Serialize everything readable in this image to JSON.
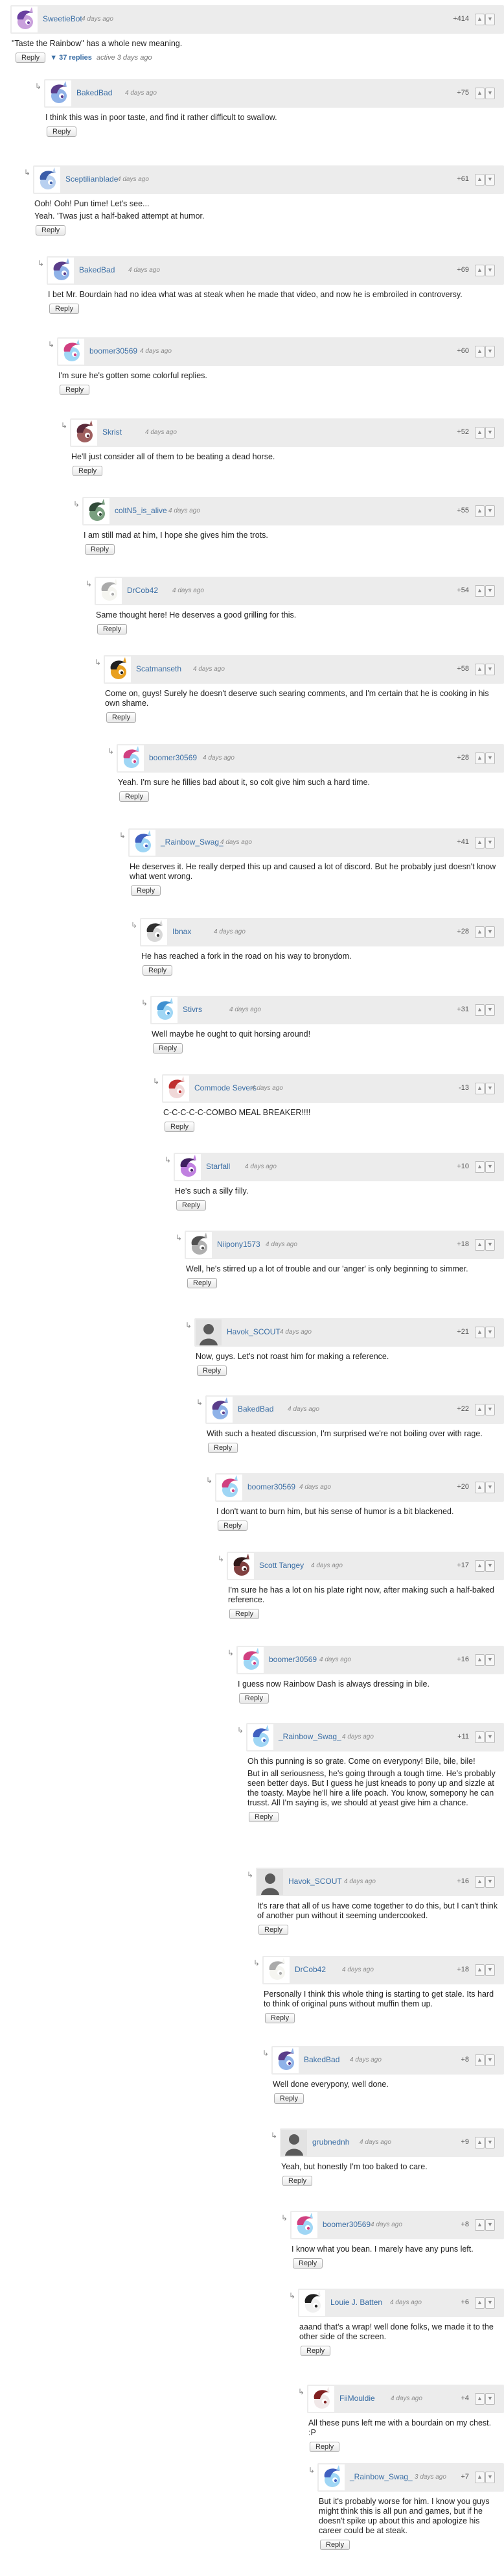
{
  "ui": {
    "reply_label": "Reply",
    "arrow_glyph": "↳",
    "up_glyph": "▲",
    "down_glyph": "▼"
  },
  "comments": [
    {
      "user": "SweetieBot",
      "time": "4 days ago",
      "score": "+414",
      "body": [
        "\"Taste the Rainbow\" has a whole new meaning."
      ],
      "replies": "▼ 37 replies",
      "active": "active 3 days ago",
      "avatar": "sweetiebot-avatar",
      "colors": [
        "#c9a0dc",
        "#6a3fa0"
      ]
    },
    {
      "user": "BakedBad",
      "time": "4 days ago",
      "score": "+75",
      "body": [
        "I think this was in poor taste, and find it rather difficult to swallow."
      ],
      "avatar": "pony-avatar",
      "colors": [
        "#8fb2e8",
        "#5a3d8a"
      ]
    },
    {
      "user": "Sceptilianblade",
      "time": "4 days ago",
      "score": "+61",
      "body": [
        "Ooh! Ooh! Pun time! Let's see...",
        "Yeah. 'Twas just a half-baked attempt at humor."
      ],
      "avatar": "pony-avatar",
      "colors": [
        "#b8d0f0",
        "#3a5ca8"
      ]
    },
    {
      "user": "BakedBad",
      "time": "4 days ago",
      "score": "+69",
      "body": [
        "I bet Mr. Bourdain had no idea what was at steak when he made that video, and now he is embroiled in controversy."
      ],
      "avatar": "pony-avatar",
      "colors": [
        "#8fb2e8",
        "#5a3d8a"
      ]
    },
    {
      "user": "boomer30569",
      "time": "4 days ago",
      "score": "+60",
      "body": [
        "I'm sure he's gotten some colorful replies."
      ],
      "avatar": "rainbow-dash-avatar",
      "colors": [
        "#9fd6f5",
        "#d04080"
      ]
    },
    {
      "user": "Skrist",
      "time": "4 days ago",
      "score": "+52",
      "body": [
        "He'll just consider all of them to be beating a dead horse."
      ],
      "avatar": "pony-avatar",
      "colors": [
        "#a06060",
        "#5a2a3a"
      ]
    },
    {
      "user": "coltN5_is_alive",
      "time": "4 days ago",
      "score": "+55",
      "body": [
        "I am still mad at him, I hope she gives him the trots."
      ],
      "avatar": "pony-avatar",
      "colors": [
        "#7aa080",
        "#304a38"
      ]
    },
    {
      "user": "DrCob42",
      "time": "4 days ago",
      "score": "+54",
      "body": [
        "Same thought here! He deserves a good grilling for this."
      ],
      "avatar": "pony-avatar",
      "colors": [
        "#f5f5f0",
        "#aaaaaa"
      ]
    },
    {
      "user": "Scatmanseth",
      "time": "4 days ago",
      "score": "+58",
      "body": [
        "Come on, guys! Surely he doesn't deserve such searing comments, and I'm certain that he is cooking in his own shame."
      ],
      "avatar": "pony-avatar",
      "colors": [
        "#e8a020",
        "#202020"
      ]
    },
    {
      "user": "boomer30569",
      "time": "4 days ago",
      "score": "+28",
      "body": [
        "Yeah. I'm sure he fillies bad about it, so colt give him such a hard time."
      ],
      "avatar": "rainbow-dash-avatar",
      "colors": [
        "#9fd6f5",
        "#d04080"
      ]
    },
    {
      "user": "_Rainbow_Swag_",
      "time": "4 days ago",
      "score": "+41",
      "body": [
        "He deserves it. He really derped this up and caused a lot of discord. But he probably just doesn't know what went wrong."
      ],
      "avatar": "rainbow-dash-avatar",
      "colors": [
        "#9fd6f5",
        "#4060c0"
      ]
    },
    {
      "user": "Ibnax",
      "time": "4 days ago",
      "score": "+28",
      "body": [
        "He has reached a fork in the road on his way to bronydom."
      ],
      "avatar": "pony-avatar",
      "colors": [
        "#d8d8d8",
        "#303030"
      ]
    },
    {
      "user": "Stivrs",
      "time": "4 days ago",
      "score": "+31",
      "body": [
        "Well maybe he ought to quit horsing around!"
      ],
      "avatar": "rainbow-dash-avatar",
      "colors": [
        "#9fd6f5",
        "#4090d0"
      ]
    },
    {
      "user": "Commode Severs",
      "time": "4 days ago",
      "score": "-13",
      "body": [
        "C-C-C-C-C-COMBO MEAL BREAKER!!!!"
      ],
      "avatar": "pony-avatar",
      "colors": [
        "#f0d8d8",
        "#c03030"
      ]
    },
    {
      "user": "Starfall",
      "time": "4 days ago",
      "score": "+10",
      "body": [
        "He's such a silly filly."
      ],
      "avatar": "pony-avatar",
      "colors": [
        "#c080e0",
        "#402060"
      ]
    },
    {
      "user": "Niipony1573",
      "time": "4 days ago",
      "score": "+18",
      "body": [
        "Well, he's stirred up a lot of trouble and our 'anger' is only beginning to simmer."
      ],
      "avatar": "pony-avatar",
      "colors": [
        "#b0b0b0",
        "#505050"
      ]
    },
    {
      "user": "Havok_SCOUT",
      "time": "4 days ago",
      "score": "+21",
      "body": [
        "Now, guys. Let's not roast him for making a reference."
      ],
      "avatar": "default-avatar",
      "colors": [
        "#9a9a9a",
        "#5a5a5a"
      ]
    },
    {
      "user": "BakedBad",
      "time": "4 days ago",
      "score": "+22",
      "body": [
        "With such a heated discussion, I'm surprised we're not boiling over with rage."
      ],
      "avatar": "pony-avatar",
      "colors": [
        "#8fb2e8",
        "#5a3d8a"
      ]
    },
    {
      "user": "boomer30569",
      "time": "4 days ago",
      "score": "+20",
      "body": [
        "I don't want to burn him, but his sense of humor is a bit blackened."
      ],
      "avatar": "rainbow-dash-avatar",
      "colors": [
        "#9fd6f5",
        "#d04080"
      ]
    },
    {
      "user": "Scott Tangey",
      "time": "4 days ago",
      "score": "+17",
      "body": [
        "I'm sure he has a lot on his plate right now, after making such a half-baked reference."
      ],
      "avatar": "pony-avatar",
      "colors": [
        "#804040",
        "#301818"
      ]
    },
    {
      "user": "boomer30569",
      "time": "4 days ago",
      "score": "+16",
      "body": [
        "I guess now Rainbow Dash is always dressing in bile."
      ],
      "avatar": "rainbow-dash-avatar",
      "colors": [
        "#9fd6f5",
        "#d04080"
      ]
    },
    {
      "user": "_Rainbow_Swag_",
      "time": "4 days ago",
      "score": "+11",
      "body": [
        "Oh this punning is so grate. Come on everypony! Bile, bile, bile!",
        "But in all seriousness, he's going through a tough time. He's probably seen better days. But I guess he just kneads to pony up and sizzle at the toasty. Maybe he'll hire a life poach. You know, somepony he can trusst. All I'm saying is, we should at yeast give him a chance."
      ],
      "avatar": "rainbow-dash-avatar",
      "colors": [
        "#9fd6f5",
        "#4060c0"
      ]
    },
    {
      "user": "Havok_SCOUT",
      "time": "4 days ago",
      "score": "+16",
      "body": [
        "It's rare that all of us have come together to do this, but I can't think of another pun without it seeming undercooked."
      ],
      "avatar": "default-avatar",
      "colors": [
        "#9a9a9a",
        "#5a5a5a"
      ]
    },
    {
      "user": "DrCob42",
      "time": "4 days ago",
      "score": "+18",
      "body": [
        "Personally I think this whole thing is starting to get stale. Its hard to think of original puns without muffin them up."
      ],
      "avatar": "pony-avatar",
      "colors": [
        "#f5f5f0",
        "#aaaaaa"
      ]
    },
    {
      "user": "BakedBad",
      "time": "4 days ago",
      "score": "+8",
      "body": [
        "Well done everypony, well done."
      ],
      "avatar": "pony-avatar",
      "colors": [
        "#8fb2e8",
        "#5a3d8a"
      ]
    },
    {
      "user": "grubnednh",
      "time": "4 days ago",
      "score": "+9",
      "body": [
        "Yeah, but honestly I'm too baked to care."
      ],
      "avatar": "default-avatar",
      "colors": [
        "#9a9a9a",
        "#5a5a5a"
      ]
    },
    {
      "user": "boomer30569",
      "time": "4 days ago",
      "score": "+8",
      "body": [
        "I know what you bean. I marely have any puns left."
      ],
      "avatar": "rainbow-dash-avatar",
      "colors": [
        "#9fd6f5",
        "#d04080"
      ]
    },
    {
      "user": "Louie J. Batten",
      "time": "4 days ago",
      "score": "+6",
      "body": [
        "aaand that's a wrap! well done folks, we made it to the other side of the screen."
      ],
      "avatar": "pony-avatar",
      "colors": [
        "#f0f0f0",
        "#202020"
      ]
    },
    {
      "user": "FiiMouldie",
      "time": "4 days ago",
      "score": "+4",
      "body": [
        "All these puns left me with a bourdain on my chest. :P"
      ],
      "avatar": "pony-avatar",
      "colors": [
        "#f0e8e8",
        "#802020"
      ]
    },
    {
      "user": "_Rainbow_Swag_",
      "time": "3 days ago",
      "score": "+7",
      "body": [
        "But it's probably worse for him. I know you guys might think this is all pun and games, but if he doesn't spike up about this and apologize his career could be at steak."
      ],
      "avatar": "rainbow-dash-avatar",
      "colors": [
        "#9fd6f5",
        "#4060c0"
      ]
    }
  ]
}
